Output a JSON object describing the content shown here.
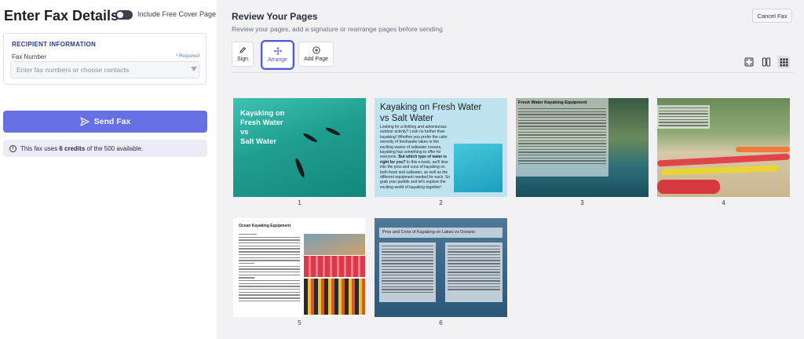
{
  "left_panel": {
    "title": "Enter Fax Details",
    "cover_page_label": "Include Free Cover Page",
    "recipient": {
      "heading": "RECIPIENT INFORMATION",
      "fax_label": "Fax Number",
      "required": "* Required",
      "placeholder": "Enter fax numbers or choose contacts"
    },
    "send_button": "Send Fax",
    "credits": {
      "prefix": "This fax uses",
      "credits_bold": "6 credits",
      "suffix": "of the 500 available."
    }
  },
  "review": {
    "title": "Review Your Pages",
    "subtitle": "Review your pages, add a signature or rearrange pages before sending",
    "cancel": "Cancel Fax",
    "tools": {
      "sign": "Sign",
      "arrange": "Arrange",
      "add_page": "Add Page"
    },
    "view_icons": [
      "fit-screen-icon",
      "two-columns-icon",
      "grid-view-icon"
    ],
    "accent_color": "#4f59d9",
    "pages": [
      {
        "number": "1",
        "title": "Kayaking on Fresh Water vs Salt Water"
      },
      {
        "number": "2",
        "title": "Kayaking on Fresh Water vs Salt Water"
      },
      {
        "number": "3",
        "title": "Fresh Water Kayaking Equipment"
      },
      {
        "number": "4"
      },
      {
        "number": "5",
        "title": "Ocean Kayaking Equipment"
      },
      {
        "number": "6",
        "title": "Pros and Cons of Kayaking on Lakes vs Oceans"
      }
    ]
  }
}
